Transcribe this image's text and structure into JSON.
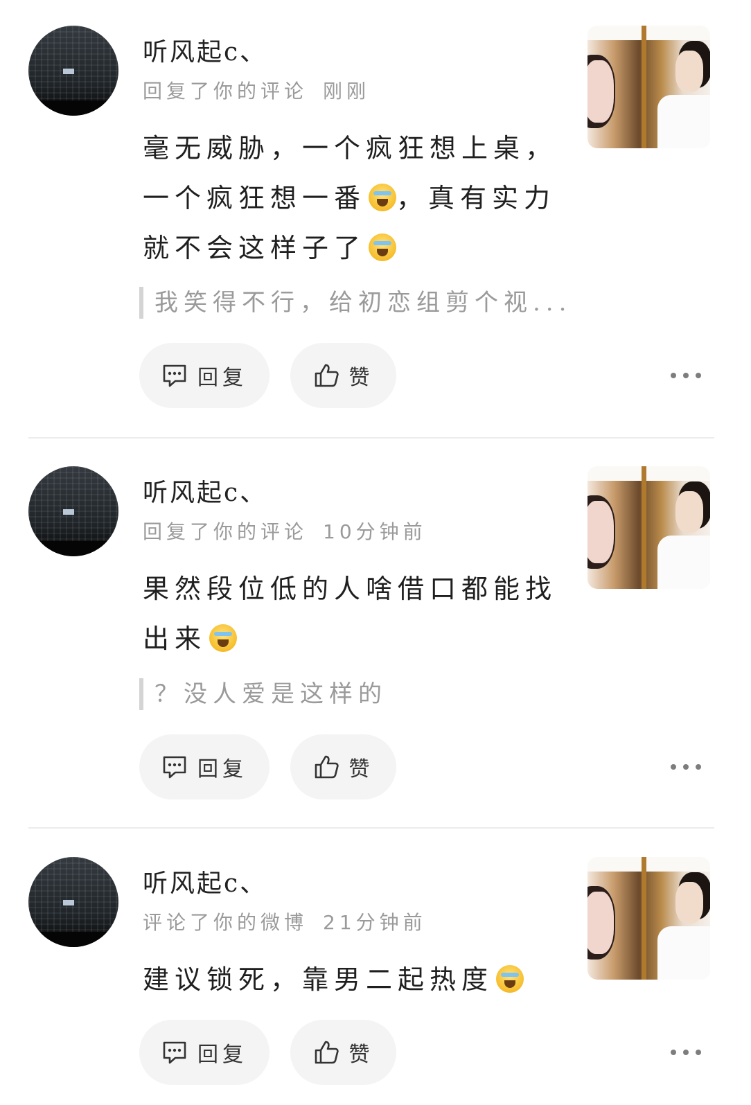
{
  "notifications": [
    {
      "username": "听风起c、",
      "action": "回复了你的评论",
      "time": "刚刚",
      "body_lines": [
        "毫无威胁，一个疯狂想上桌，",
        "一个疯狂想一番",
        "，真有实力",
        "就不会这样子了"
      ],
      "quote": "我笑得不行，给初恋组剪个视...",
      "reply_label": "回复",
      "like_label": "赞",
      "avatar_icon": "city-night-avatar",
      "emoji_icon": "crying-laughing-emoji"
    },
    {
      "username": "听风起c、",
      "action": "回复了你的评论",
      "time": "10分钟前",
      "body_lines": [
        "果然段位低的人啥借口都能找",
        "出来"
      ],
      "quote": "？没人爱是这样的",
      "reply_label": "回复",
      "like_label": "赞",
      "avatar_icon": "city-night-avatar",
      "emoji_icon": "crying-laughing-emoji"
    },
    {
      "username": "听风起c、",
      "action": "评论了你的微博",
      "time": "21分钟前",
      "body_lines": [
        "建议锁死，靠男二起热度"
      ],
      "quote": "",
      "reply_label": "回复",
      "like_label": "赞",
      "avatar_icon": "city-night-avatar",
      "emoji_icon": "crying-laughing-emoji"
    }
  ],
  "colors": {
    "background": "#ffffff",
    "meta_text": "#9a9a9a",
    "button_bg": "#f4f4f4",
    "divider": "#ececec"
  }
}
